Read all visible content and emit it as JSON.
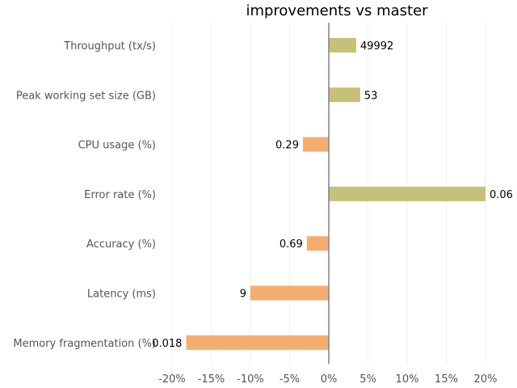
{
  "chart_data": {
    "type": "bar",
    "orientation": "horizontal",
    "title": "improvements vs master",
    "xlabel": "",
    "ylabel": "",
    "xlim": [
      -0.2,
      0.2
    ],
    "x_ticks": [
      -0.2,
      -0.15,
      -0.1,
      -0.05,
      0,
      0.05,
      0.1,
      0.15,
      0.2
    ],
    "x_tick_labels": [
      "-20%",
      "-15%",
      "-10%",
      "-5%",
      "0%",
      "5%",
      "10%",
      "15%",
      "20%"
    ],
    "grid": true,
    "categories": [
      "Throughput (tx/s)",
      "Peak working set size (GB)",
      "CPU usage (%)",
      "Error rate (%)",
      "Accuracy (%)",
      "Latency (ms)",
      "Memory fragmentation (%)"
    ],
    "values": [
      0.035,
      0.04,
      -0.033,
      0.2,
      -0.028,
      -0.1,
      -0.182
    ],
    "data_labels": [
      "49992",
      "53",
      "0.29",
      "0.06",
      "0.69",
      "9",
      "0.018"
    ],
    "colors": {
      "positive": "#c5c17a",
      "negative": "#f5ad6f",
      "zero_line": "#808080",
      "grid": "#efefef"
    }
  }
}
